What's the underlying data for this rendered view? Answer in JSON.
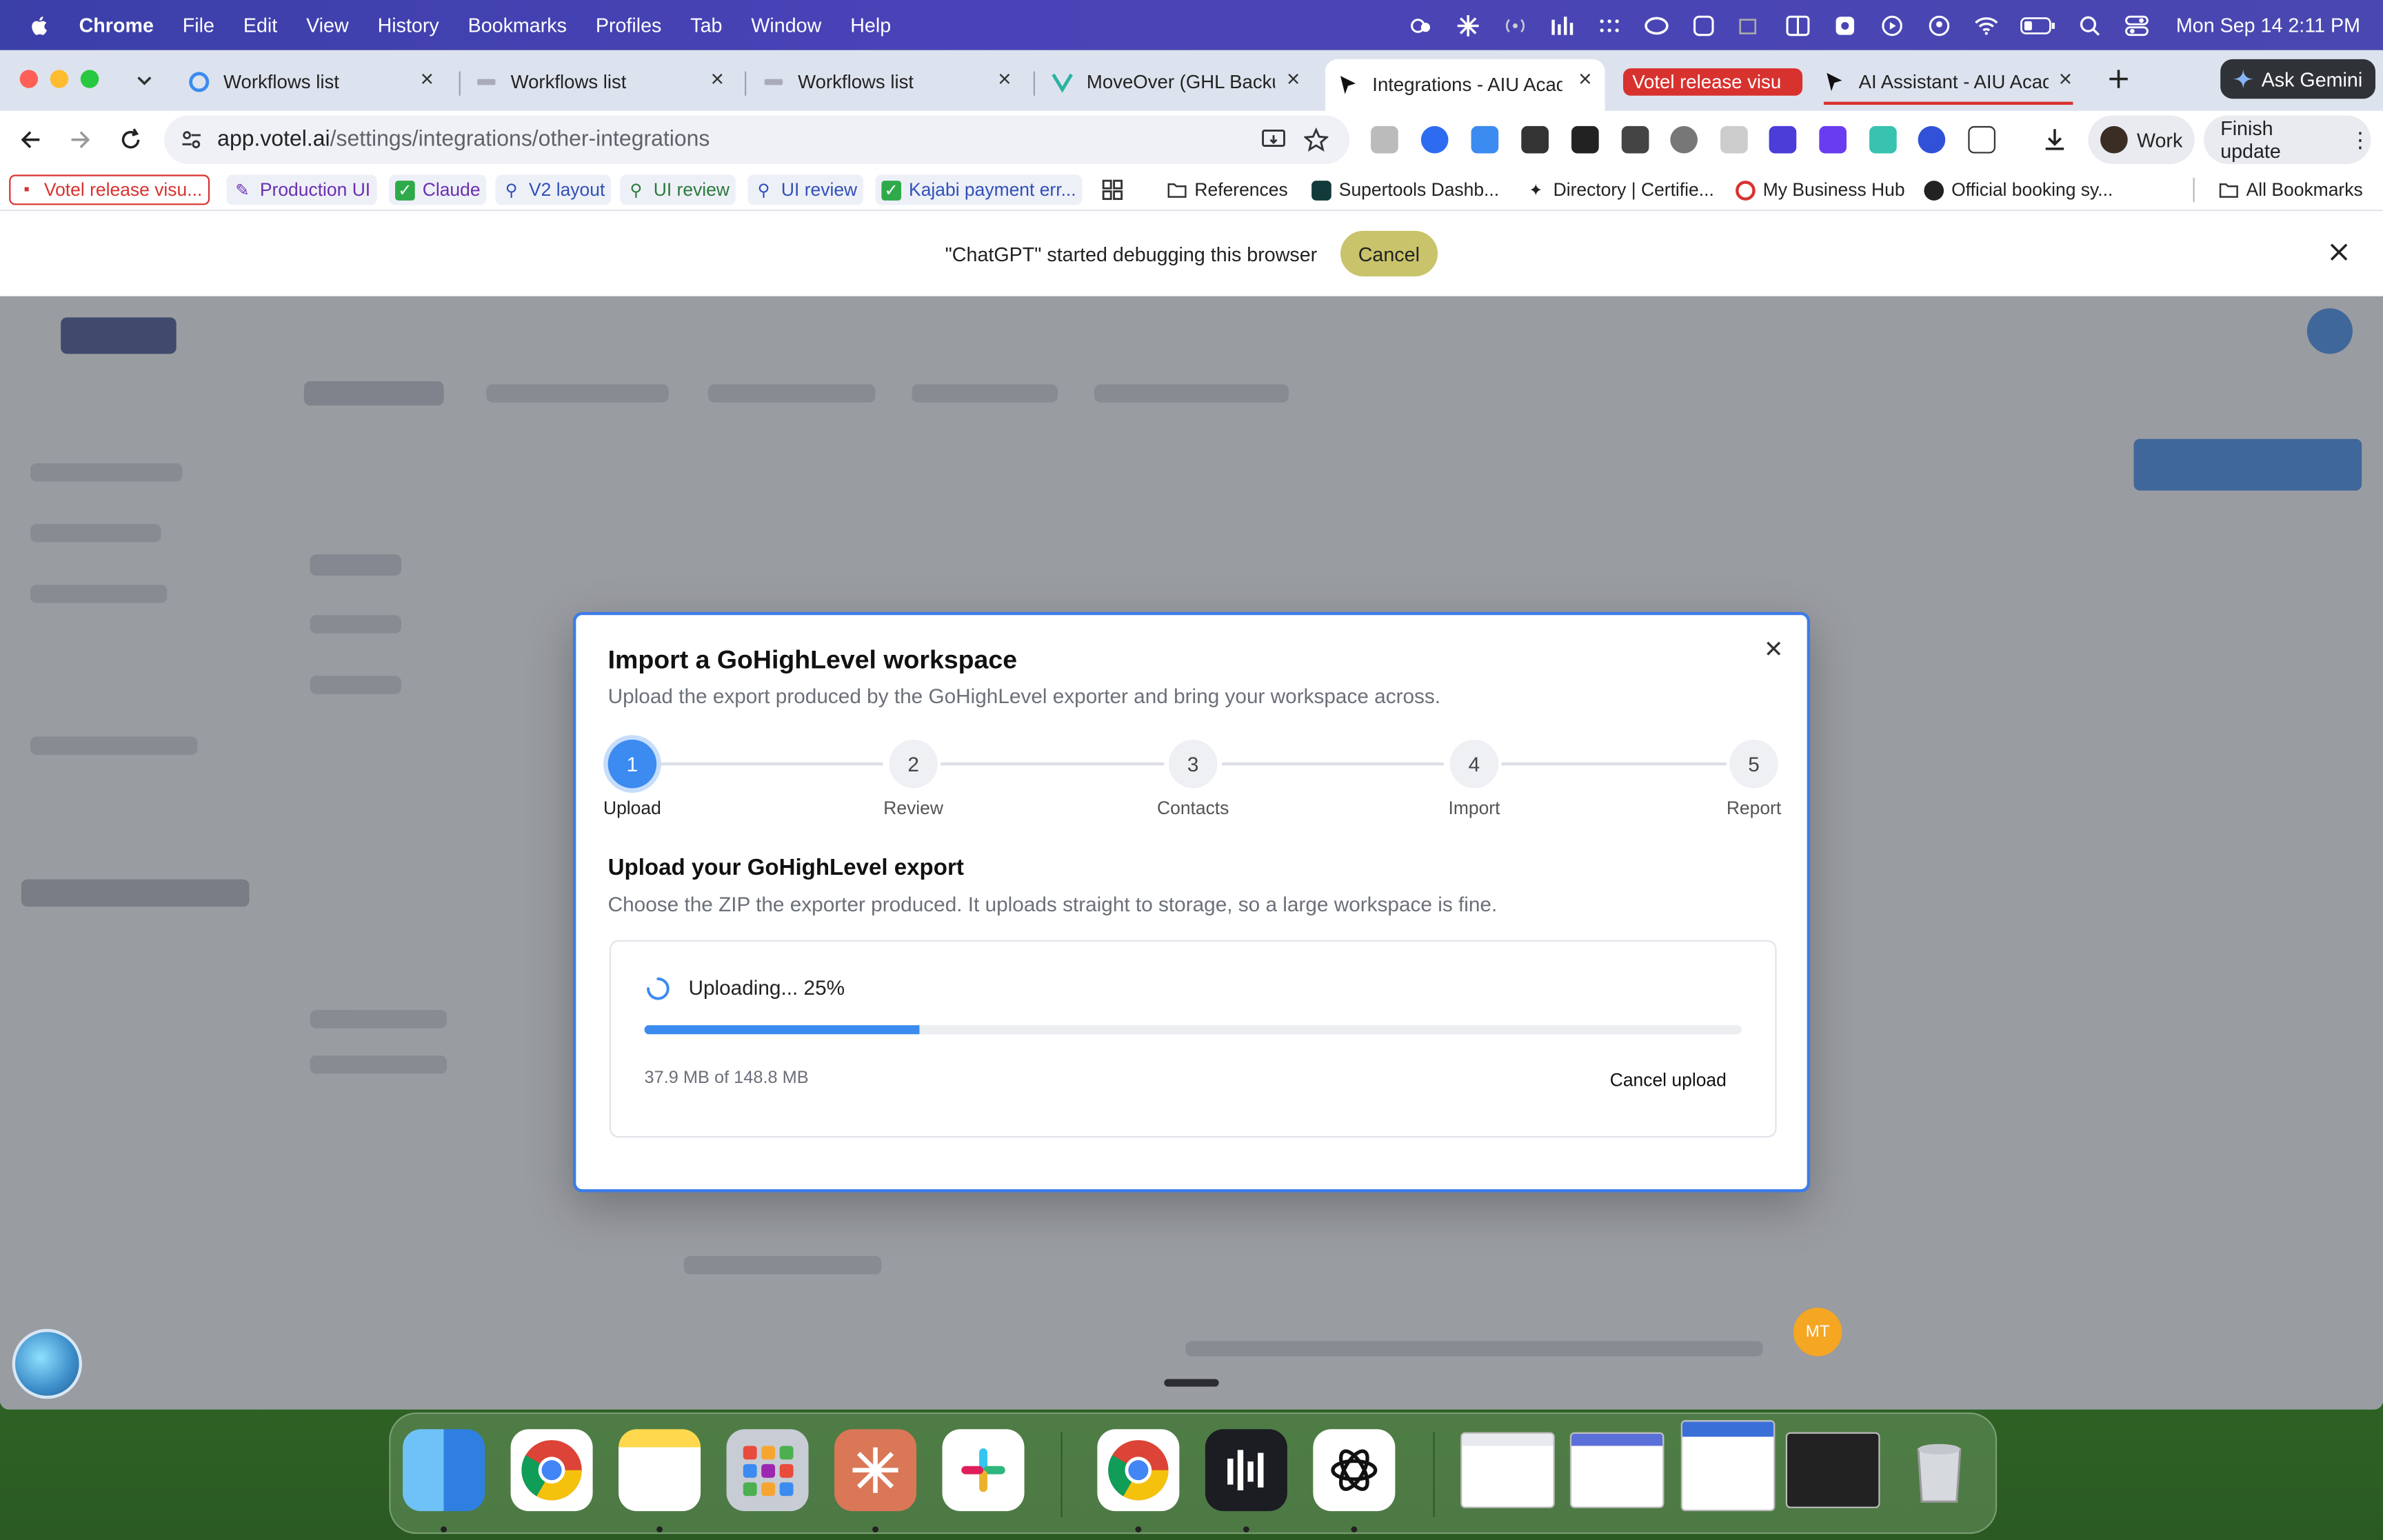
{
  "menubar": {
    "app": "Chrome",
    "items": [
      "File",
      "Edit",
      "View",
      "History",
      "Bookmarks",
      "Profiles",
      "Tab",
      "Window",
      "Help"
    ],
    "datetime": "Mon Sep 14  2:11 PM"
  },
  "tabs": [
    {
      "title": "Workflows list"
    },
    {
      "title": "Workflows list"
    },
    {
      "title": "Workflows list"
    },
    {
      "title": "MoveOver (GHL Backup"
    },
    {
      "title": "Integrations - AIU Acade"
    },
    {
      "title": "Votel release visu"
    },
    {
      "title": "AI Assistant - AIU Acade"
    }
  ],
  "toolbar": {
    "url_domain": "app.votel.ai",
    "url_path": "/settings/integrations/other-integrations",
    "profile": "Work",
    "finish_update": "Finish update",
    "ask_gemini": "Ask Gemini"
  },
  "bookmarks": {
    "items": [
      "Votel release visu...",
      "Production UI",
      "Claude",
      "V2 layout",
      "UI review",
      "UI review",
      "Kajabi payment err...",
      "References",
      "Supertools Dashb...",
      "Directory | Certifie...",
      "My Business Hub",
      "Official booking sy..."
    ],
    "all": "All Bookmarks"
  },
  "debug_banner": {
    "message": "\"ChatGPT\" started debugging this browser",
    "cancel": "Cancel"
  },
  "modal": {
    "title": "Import a GoHighLevel workspace",
    "subtitle": "Upload the export produced by the GoHighLevel exporter and bring your workspace across.",
    "steps": [
      {
        "num": "1",
        "label": "Upload"
      },
      {
        "num": "2",
        "label": "Review"
      },
      {
        "num": "3",
        "label": "Contacts"
      },
      {
        "num": "4",
        "label": "Import"
      },
      {
        "num": "5",
        "label": "Report"
      }
    ],
    "section_title": "Upload your GoHighLevel export",
    "section_sub": "Choose the ZIP the exporter produced. It uploads straight to storage, so a large workspace is fine.",
    "status": "Uploading... 25%",
    "progress": 0.25,
    "bytes": "37.9 MB of 148.8 MB",
    "cancel_upload": "Cancel upload"
  },
  "avatar": "MT",
  "colors": {
    "accent": "#3b8bf0",
    "modal_border": "#3d7be8",
    "debug_cancel": "#c9c36b",
    "red_tag": "#d8322f"
  }
}
